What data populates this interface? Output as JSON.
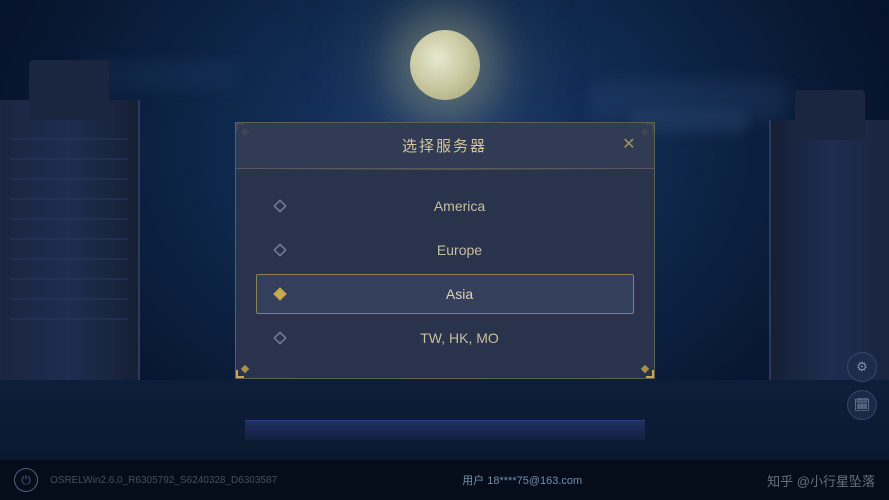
{
  "background": {
    "moon_color": "#e0e0c0"
  },
  "dialog": {
    "title": "选择服务器",
    "close_label": "✕",
    "servers": [
      {
        "id": "america",
        "name": "America",
        "selected": false
      },
      {
        "id": "europe",
        "name": "Europe",
        "selected": false
      },
      {
        "id": "asia",
        "name": "Asia",
        "selected": true
      },
      {
        "id": "twhkmo",
        "name": "TW, HK, MO",
        "selected": false
      }
    ]
  },
  "bottombar": {
    "version": "OSRELWin2.6.0_R6305792_S6240328_D6303587",
    "user_label": "用户",
    "user_account": "18****75@163.com",
    "watermark": "知乎 @小行星坠落"
  },
  "icons": {
    "power": "⏻",
    "settings": "⚙",
    "calendar": "📅"
  }
}
